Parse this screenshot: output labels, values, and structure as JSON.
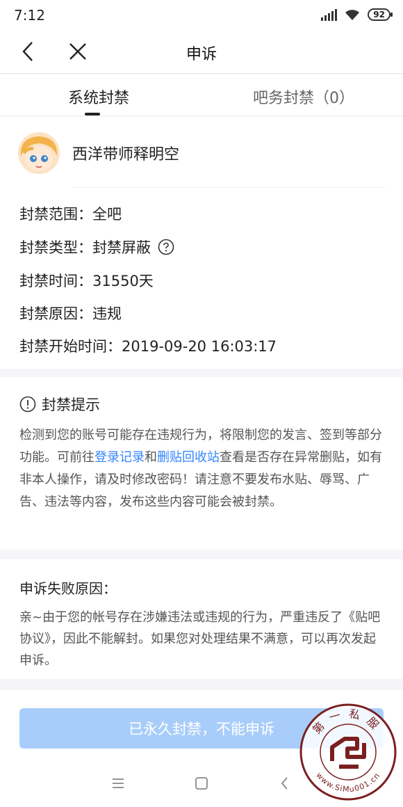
{
  "status": {
    "time": "7:12",
    "battery": "92"
  },
  "nav": {
    "title": "申诉"
  },
  "tabs": {
    "system": "系统封禁",
    "bar": "吧务封禁（0）"
  },
  "user": {
    "name": "西洋带师释明空"
  },
  "ban": {
    "scope": "封禁范围：全吧",
    "type": "封禁类型：封禁屏蔽",
    "duration": "封禁时间：31550天",
    "reason": "封禁原因：违规",
    "start": "封禁开始时间：2019-09-20 16:03:17"
  },
  "tip": {
    "title": "封禁提示",
    "text_1": "检测到您的账号可能存在违规行为，将限制您的发言、签到等部分功能。可前往",
    "link_login": "登录记录",
    "text_and": "和",
    "link_recycle": "删贴回收站",
    "text_2": "查看是否存在异常删贴，如有非本人操作，请及时修改密码！请注意不要发布水贴、辱骂、广告、违法等内容，发布这些内容可能会被封禁。"
  },
  "appeal": {
    "title": "申诉失败原因：",
    "text": "亲~由于您的帐号存在涉嫌违法或违规的行为，严重违反了《贴吧协议》，因此不能解封。如果您对处理结果不满意，可以再次发起申诉。"
  },
  "button": {
    "label": "已永久封禁，不能申诉"
  },
  "watermark": {
    "top": "第一私服",
    "bottom": "www.SiMu001.cn"
  },
  "colors": {
    "link": "#3385ff",
    "button_disabled": "#a9cdfa",
    "page_bg": "#f5f5f7"
  }
}
